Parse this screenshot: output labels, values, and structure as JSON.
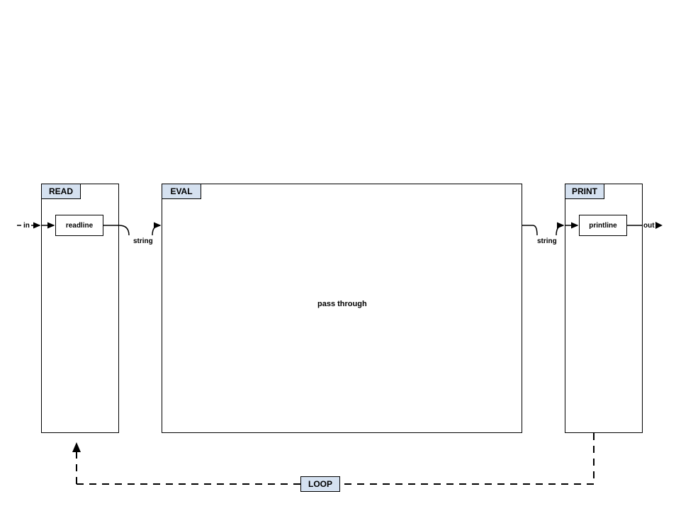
{
  "headers": {
    "read": "READ",
    "eval": "EVAL",
    "print": "PRINT",
    "loop": "LOOP"
  },
  "nodes": {
    "readline": "readline",
    "printline": "printline",
    "passthrough": "pass through"
  },
  "labels": {
    "in": "in",
    "out": "out",
    "string1": "string",
    "string2": "string"
  }
}
